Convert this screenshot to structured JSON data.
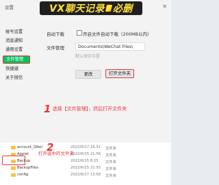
{
  "window": {
    "title": "设置",
    "banner": "VX聊天记录",
    "banner_suffix": "必删",
    "close": "✕"
  },
  "sidebar": {
    "items": [
      {
        "label": "帐号设置"
      },
      {
        "label": "消息通知"
      },
      {
        "label": "通用设置"
      },
      {
        "label": "文件管理"
      },
      {
        "label": "快捷键"
      },
      {
        "label": "关于微信"
      }
    ],
    "active_index": 3
  },
  "settings": {
    "auto_download_label": "自动下载",
    "auto_download_option": "开启文件自动下载（200MB以内）",
    "file_mgmt_label": "文件管理",
    "path_value": "Documents\\WeChat Files\\",
    "hint": "默认保存位置",
    "change_button": "更改",
    "open_folder_button": "打开文件夹"
  },
  "annotations": {
    "step1_num": "1",
    "step1_text": "选择【文件管理】，然后打开文件夹",
    "step2_num": "2",
    "step2_text": "打开选中的文件夹"
  },
  "explorer": {
    "files": [
      {
        "name": "account_Qikei",
        "date": "2022/6/17 16:51",
        "type": "文件夹"
      },
      {
        "name": "Applet",
        "date": "2022/6/15 21:56",
        "type": "文件夹"
      },
      {
        "name": "Backup",
        "date": "2022/6/15 8:25",
        "type": "文件夹"
      },
      {
        "name": "BackupFiles",
        "date": "2022/6/15 21:55",
        "type": "文件夹"
      },
      {
        "name": "config",
        "date": "2022/6/17 13:58",
        "type": "文件夹"
      }
    ]
  }
}
